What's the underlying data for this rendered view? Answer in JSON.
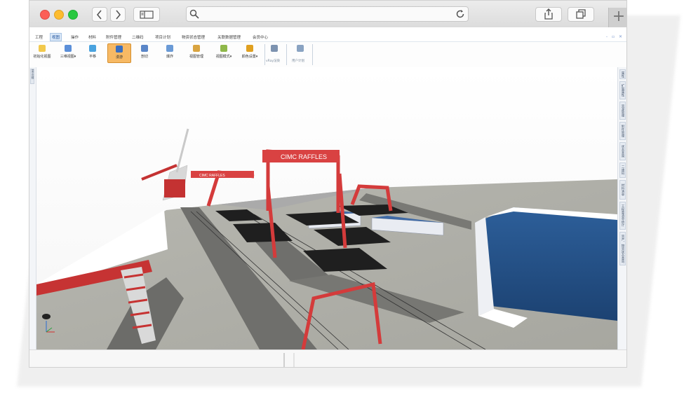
{
  "menu_tabs": [
    {
      "label": "工程",
      "active": false
    },
    {
      "label": "视图",
      "active": true
    },
    {
      "label": "操作",
      "active": false
    },
    {
      "label": "材料",
      "active": false
    },
    {
      "label": "附件管理",
      "active": false
    },
    {
      "label": "二维码",
      "active": false
    },
    {
      "label": "项目计划",
      "active": false
    },
    {
      "label": "物资状态管理",
      "active": false
    },
    {
      "label": "关联数据管理",
      "active": false
    },
    {
      "label": "会员中心",
      "active": false
    }
  ],
  "window_controls": "- ▫ ✕",
  "ribbon": [
    {
      "label": "初始化视图",
      "icon": "init-view-icon",
      "color": "#f2c94c"
    },
    {
      "label": "三维视图",
      "icon": "3d-view-icon",
      "color": "#5b8fd9"
    },
    {
      "label": "平移",
      "icon": "pan-icon",
      "color": "#4aa3df"
    },
    {
      "label": "漫游",
      "icon": "walk-icon",
      "color": "#3a6fbf",
      "active": true
    },
    {
      "label": "剖切",
      "icon": "section-icon",
      "color": "#5a86c8"
    },
    {
      "label": "爆炸",
      "icon": "explode-icon",
      "color": "#6a9ad6"
    },
    {
      "label": "视图管理",
      "icon": "view-manage-icon",
      "color": "#d9a441"
    },
    {
      "label": "视图模式",
      "icon": "view-mode-icon",
      "color": "#8fb84a"
    },
    {
      "label": "颜色设置",
      "icon": "color-settings-icon",
      "color": "#e0a020"
    },
    {
      "label": "",
      "icon": "cube-icon",
      "color": "#7d93b0"
    },
    {
      "label": "",
      "icon": "pipe-plan-icon",
      "color": "#8aa3c2"
    }
  ],
  "ribbon_groups": [
    "vRay渲染",
    "用户计划"
  ],
  "left_panel_tab": "显示控制",
  "right_panel_tabs": [
    "属性",
    "扩展属性",
    "资源管理",
    "附件管理",
    "状态查询",
    "二维码",
    "材料清单",
    "工程量清单统计",
    "资产、物资状态查询"
  ],
  "scene": {
    "gantry_sign_left": "CIMC RAFFLES",
    "gantry_sign_main": "CIMC RAFFLES"
  }
}
